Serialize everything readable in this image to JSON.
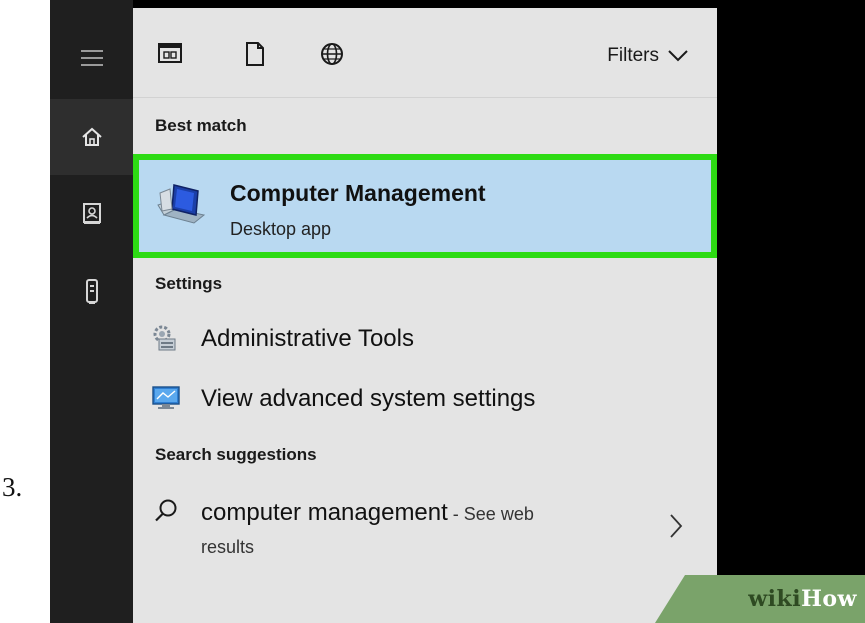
{
  "step": {
    "number": "3."
  },
  "taskbar": {
    "icons": [
      "hamburger-menu-icon",
      "home-icon",
      "notebook-icon",
      "device-icon"
    ]
  },
  "search_panel": {
    "toolbar": {
      "icons": [
        "apps-icon",
        "documents-icon",
        "web-icon"
      ],
      "filters_label": "Filters"
    },
    "best_match": {
      "header": "Best match",
      "title": "Computer Management",
      "subtitle": "Desktop app",
      "highlight_color": "#2ddb14",
      "selected_background": "#b9d9f1"
    },
    "settings": {
      "header": "Settings",
      "items": [
        {
          "label": "Administrative Tools",
          "icon": "administrative-tools-icon"
        },
        {
          "label": "View advanced system settings",
          "icon": "system-settings-icon"
        }
      ]
    },
    "search_suggestions": {
      "header": "Search suggestions",
      "query": "computer management",
      "suffix": " - See web",
      "suffix_line2": "results"
    }
  },
  "watermark": {
    "part1": "wiki",
    "part2": "How"
  }
}
